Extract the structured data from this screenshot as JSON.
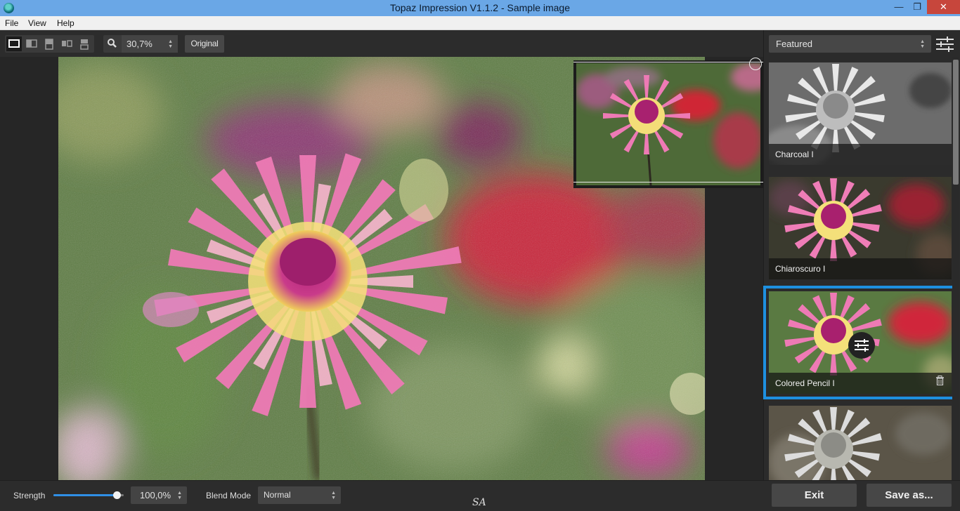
{
  "window": {
    "title": "Topaz Impression V1.1.2 - Sample image",
    "minimize_glyph": "—",
    "maximize_glyph": "❐",
    "close_glyph": "✕"
  },
  "menu": {
    "file": "File",
    "view": "View",
    "help": "Help"
  },
  "toolbar": {
    "view_modes": [
      "single-view-icon",
      "split-vertical-icon",
      "split-horizontal-icon",
      "side-by-side-icon",
      "stacked-icon"
    ],
    "active_view_mode": 0,
    "zoom_value": "30,7%",
    "original_label": "Original"
  },
  "presets_panel": {
    "category": "Featured",
    "presets": [
      {
        "label": "Charcoal I",
        "style": "charcoal",
        "selected": false
      },
      {
        "label": "Chiaroscuro I",
        "style": "chiaroscuro",
        "selected": false
      },
      {
        "label": "Colored Pencil I",
        "style": "pencil",
        "selected": true
      },
      {
        "label": "",
        "style": "charcoal2",
        "selected": false
      }
    ]
  },
  "bottom": {
    "strength_label": "Strength",
    "strength_value": "100,0%",
    "strength_fraction": 0.9,
    "blend_label": "Blend Mode",
    "blend_value": "Normal",
    "signature": "SA",
    "exit_label": "Exit",
    "save_label": "Save as..."
  },
  "colors": {
    "accent": "#1e90e0",
    "title_bar": "#6aa7e6",
    "close_button": "#c7463c"
  }
}
